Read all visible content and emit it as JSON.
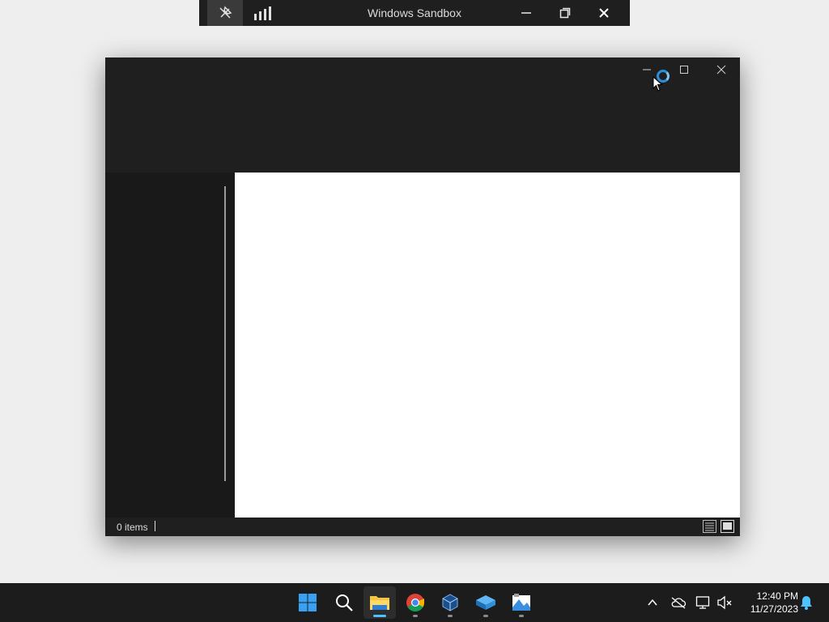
{
  "sandbox_bar": {
    "title": "Windows Sandbox",
    "icons": [
      "pin-icon",
      "signal-bars-icon",
      "minimize-icon",
      "restore-icon",
      "close-icon"
    ]
  },
  "explorer_window": {
    "status": {
      "item_count": "0 items"
    },
    "view_buttons": [
      "details-view-icon",
      "large-icons-view-icon"
    ],
    "title_buttons": [
      "minimize-icon",
      "maximize-icon",
      "close-icon"
    ]
  },
  "taskbar": {
    "apps": [
      {
        "name": "start",
        "icon": "windows-start-icon"
      },
      {
        "name": "search",
        "icon": "search-icon"
      },
      {
        "name": "file-explorer",
        "icon": "folder-icon",
        "active": true
      },
      {
        "name": "chrome",
        "icon": "chrome-icon"
      },
      {
        "name": "virtualbox",
        "icon": "cube-icon"
      },
      {
        "name": "sandbox",
        "icon": "sandbox-icon"
      },
      {
        "name": "snipping",
        "icon": "app-icon"
      }
    ],
    "clock": {
      "time": "12:40 PM",
      "date": "11/27/2023"
    }
  },
  "colors": {
    "accent": "#4cc2ff",
    "window_bg": "#1f1f1f",
    "taskbar_bg": "#1c1c1c"
  }
}
